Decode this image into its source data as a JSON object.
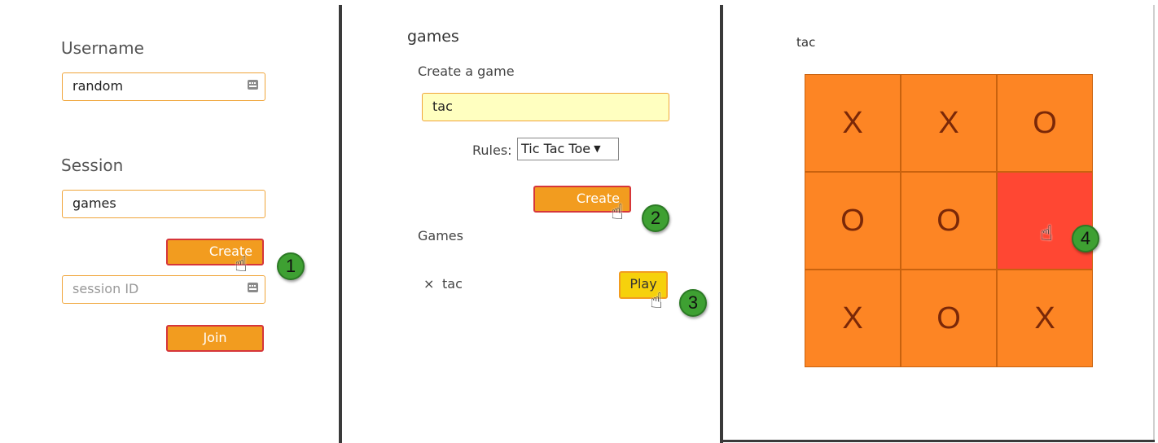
{
  "login": {
    "username_label": "Username",
    "username_value": "random",
    "session_label": "Session",
    "session_value": "games",
    "create_label": "Create",
    "session_id_placeholder": "session ID",
    "join_label": "Join",
    "step": "1"
  },
  "games": {
    "title": "games",
    "create_heading": "Create a game",
    "game_name_value": "tac",
    "rules_label": "Rules:",
    "rules_selected": "Tic Tac Toe",
    "create_label": "Create",
    "create_step": "2",
    "list_heading": "Games",
    "list": [
      {
        "remove": "×",
        "name": "tac",
        "play_label": "Play"
      }
    ],
    "play_step": "3"
  },
  "board": {
    "title": "tac",
    "cells": [
      "X",
      "X",
      "O",
      "O",
      "O",
      "",
      "X",
      "O",
      "X"
    ],
    "highlighted_cell": 5,
    "step": "4"
  },
  "colors": {
    "button_orange": "#f29c1f",
    "button_border": "#d6363a",
    "play_yellow": "#f6d10c",
    "cell_orange": "#fd8524",
    "cell_highlight": "#ff4733",
    "step_green": "#3ea032",
    "arrow_orange": "#f28a1c"
  },
  "icons": {
    "pointer": "hand-pointer-icon",
    "keyboard": "keyboard-icon",
    "arrow": "arrow-right-icon"
  }
}
